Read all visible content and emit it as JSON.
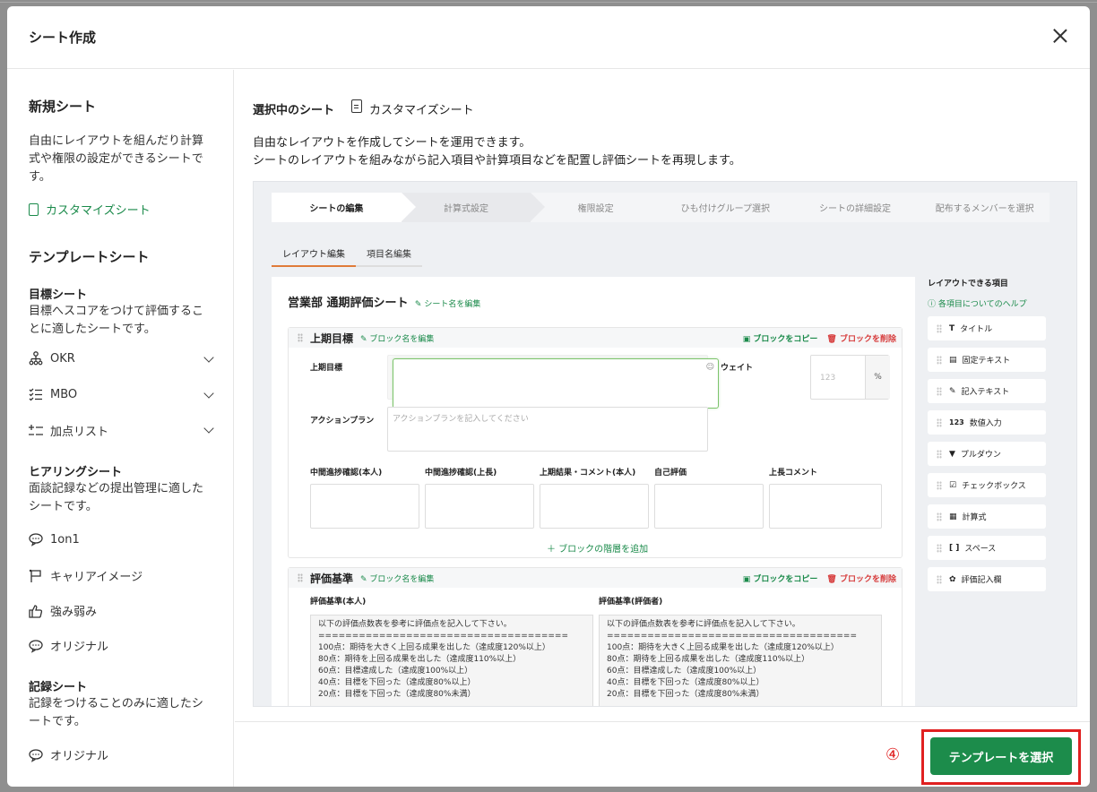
{
  "modal": {
    "title": "シート作成"
  },
  "sidebar": {
    "new_sheet": {
      "heading": "新規シート",
      "desc": "自由にレイアウトを組んだり計算式や権限の設定ができるシートです。",
      "link": "カスタマイズシート"
    },
    "template_heading": "テンプレートシート",
    "goal": {
      "heading": "目標シート",
      "desc": "目標へスコアをつけて評価することに適したシートです。",
      "items": [
        "OKR",
        "MBO",
        "加点リスト"
      ]
    },
    "hearing": {
      "heading": "ヒアリングシート",
      "desc": "面談記録などの提出管理に適したシートです。",
      "items": [
        "1on1",
        "キャリアイメージ",
        "強み弱み",
        "オリジナル"
      ]
    },
    "record": {
      "heading": "記録シート",
      "desc": "記録をつけることのみに適したシートです。",
      "items": [
        "オリジナル"
      ]
    }
  },
  "main": {
    "selected_label": "選択中のシート",
    "selected_value": "カスタマイズシート",
    "desc_line1": "自由なレイアウトを作成してシートを運用できます。",
    "desc_line2": "シートのレイアウトを組みながら記入項目や計算項目などを配置し評価シートを再現します。",
    "steps": [
      "シートの編集",
      "計算式設定",
      "権限設定",
      "ひも付けグループ選択",
      "シートの詳細設定",
      "配布するメンバーを選択"
    ],
    "subtabs": [
      "レイアウト編集",
      "項目名編集"
    ],
    "sheet_title": "営業部 通期評価シート",
    "rename_sheet": "シート名を編集",
    "block1": {
      "title": "上期目標",
      "rename": "ブロック名を編集",
      "copy": "ブロックをコピー",
      "delete": "ブロックを削除",
      "goal_label": "上期目標",
      "weight_label": "ウェイト",
      "weight_placeholder": "123",
      "weight_unit": "%",
      "action_label": "アクションプラン",
      "action_placeholder": "アクションプランを記入してください",
      "columns": [
        "中間進捗確認(本人)",
        "中間進捗確認(上長)",
        "上期結果・コメント(本人)",
        "自己評価",
        "上長コメント"
      ],
      "add_layer": "ブロックの階層を追加"
    },
    "block2": {
      "title": "評価基準",
      "rename": "ブロック名を編集",
      "copy": "ブロックをコピー",
      "delete": "ブロックを削除",
      "left_label": "評価基準(本人)",
      "right_label": "評価基準(評価者)",
      "text": "以下の評価点数表を参考に評価点を記入して下さい。\n=====================================\n100点：期待を大きく上回る成果を出した（達成度120%以上）\n80点：期待を上回る成果を出した（達成度110%以上）\n60点：目標達成した（達成度100%以上）\n40点：目標を下回った（達成度80%以上）\n20点：目標を下回った（達成度80%未満）"
    },
    "palette": {
      "title": "レイアウトできる項目",
      "help": "各項目についてのヘルプ",
      "items": [
        "タイトル",
        "固定テキスト",
        "記入テキスト",
        "数値入力",
        "プルダウン",
        "チェックボックス",
        "計算式",
        "スペース",
        "評価記入欄"
      ],
      "icons": [
        "T",
        "▤",
        "✎",
        "123",
        "▼",
        "☑",
        "▦",
        "[ ]",
        "✿"
      ]
    }
  },
  "footer": {
    "step_marker": "④",
    "select_button": "テンプレートを選択"
  },
  "colors": {
    "accent": "#1c8c4b",
    "highlight": "#e02020"
  }
}
